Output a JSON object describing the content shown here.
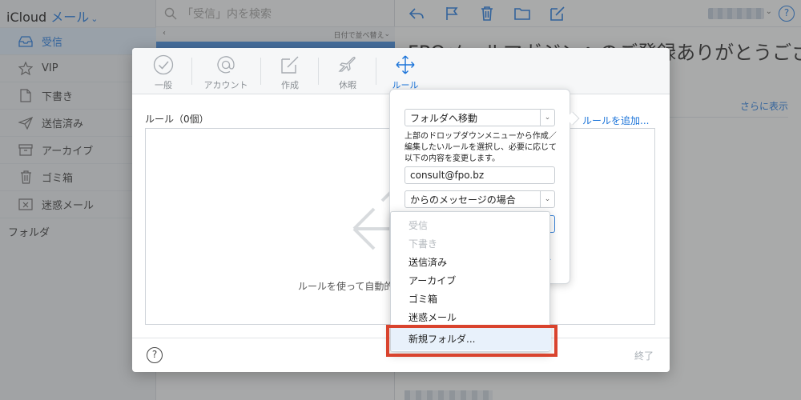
{
  "app": {
    "title_main": "iCloud",
    "title_app": "メール"
  },
  "sidebar": {
    "items": [
      {
        "label": "受信"
      },
      {
        "label": "VIP"
      },
      {
        "label": "下書き"
      },
      {
        "label": "送信済み"
      },
      {
        "label": "アーカイブ"
      },
      {
        "label": "ゴミ箱"
      },
      {
        "label": "迷惑メール"
      }
    ],
    "section_label": "フォルダ"
  },
  "list_pane": {
    "search_placeholder": "「受信」内を検索",
    "sort_label": "日付で並べ替え"
  },
  "message": {
    "subject": "FPOメールマガジンへのご登録ありがとうござ",
    "show_more": "さらに表示"
  },
  "modal": {
    "tabs": [
      {
        "label": "一般",
        "icon": "checkmark-icon"
      },
      {
        "label": "アカウント",
        "icon": "at-icon"
      },
      {
        "label": "作成",
        "icon": "compose-icon"
      },
      {
        "label": "休暇",
        "icon": "airplane-icon"
      },
      {
        "label": "ルール",
        "icon": "rules-icon"
      }
    ],
    "active_tab": "ルール",
    "rules_label": "ルール（0個）",
    "add_rule": "ルールを追加...",
    "empty_text": "ルールを使って自動的",
    "done": "終了",
    "help": "?"
  },
  "popover": {
    "action_select": "フォルダへ移動",
    "description": "上部のドロップダウンメニューから作成／編集したいルールを選択し、必要に応じて以下の内容を変更します。",
    "address_value": "consult@fpo.bz",
    "condition_select": "からのメッセージの場合"
  },
  "dropdown": {
    "items": [
      {
        "label": "受信",
        "enabled": false
      },
      {
        "label": "下書き",
        "enabled": false
      },
      {
        "label": "送信済み",
        "enabled": true
      },
      {
        "label": "アーカイブ",
        "enabled": true
      },
      {
        "label": "ゴミ箱",
        "enabled": true
      },
      {
        "label": "迷惑メール",
        "enabled": true
      }
    ],
    "new_folder": "新規フォルダ..."
  },
  "colors": {
    "accent": "#1a73d9",
    "highlight": "#d9432d"
  }
}
